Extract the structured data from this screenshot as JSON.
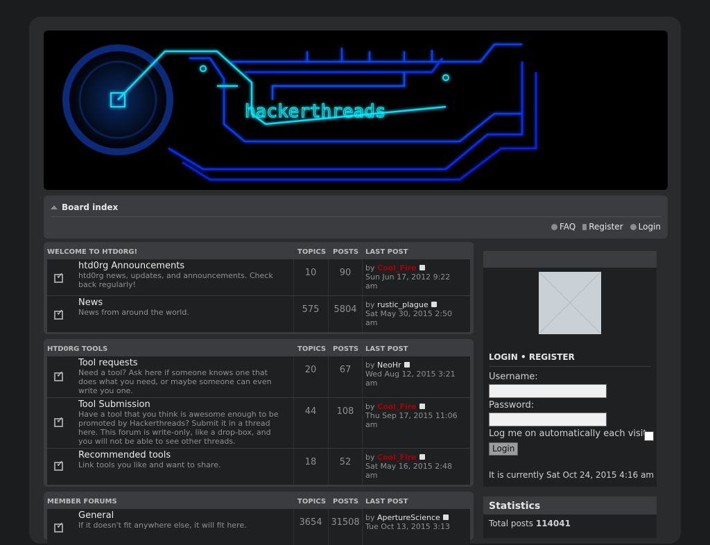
{
  "banner": {
    "title": "hackerthreads"
  },
  "nav": {
    "breadcrumb": "Board index",
    "faq": "FAQ",
    "register": "Register",
    "login": "Login"
  },
  "forums": {
    "col_topics": "TOPICS",
    "col_posts": "POSTS",
    "col_last": "LAST POST",
    "cat1": {
      "title": "WELCOME TO HTD0RG!",
      "rows": [
        {
          "name": "htd0rg Announcements",
          "desc": "htd0rg news, updates, and announcements. Check back regularly!",
          "topics": "10",
          "posts": "90",
          "by": "by",
          "user": "Cool_Fire",
          "date": "Sun Jun 17, 2012 9:22 am"
        },
        {
          "name": "News",
          "desc": "News from around the world.",
          "topics": "575",
          "posts": "5804",
          "by": "by",
          "user": "rustic_plague",
          "date": "Sat May 30, 2015 2:50 am"
        }
      ]
    },
    "cat2": {
      "title": "HTD0RG TOOLS",
      "rows": [
        {
          "name": "Tool requests",
          "desc": "Need a tool? Ask here if someone knows one that does what you need, or maybe someone can even write you one.",
          "topics": "20",
          "posts": "67",
          "by": "by",
          "user": "NeoHr",
          "date": "Wed Aug 12, 2015 3:21 am"
        },
        {
          "name": "Tool Submission",
          "desc": "Have a tool that you think is awesome enough to be promoted by Hackerthreads? Submit it in a thread here. This forum is write-only, like a drop-box, and you will not be able to see other threads.",
          "topics": "44",
          "posts": "108",
          "by": "by",
          "user": "Cool_Fire",
          "date": "Thu Sep 17, 2015 11:06 am"
        },
        {
          "name": "Recommended tools",
          "desc": "Link tools you like and want to share.",
          "topics": "18",
          "posts": "52",
          "by": "by",
          "user": "Cool_Fire",
          "date": "Sat May 16, 2015 2:48 am"
        }
      ]
    },
    "cat3": {
      "title": "MEMBER FORUMS",
      "rows": [
        {
          "name": "General",
          "desc": "If it doesn't fit anywhere else, it will fit here.",
          "topics": "3654",
          "posts": "31508",
          "by": "by",
          "user": "ApertureScience",
          "date": "Tue Oct 13, 2015 3:13"
        }
      ]
    }
  },
  "sidebar": {
    "login": "LOGIN",
    "bullet": "•",
    "register": "REGISTER",
    "username_label": "Username:",
    "password_label": "Password:",
    "remember_label": "Log me on automatically each visit",
    "login_button": "Login",
    "current_time": "It is currently Sat Oct 24, 2015 4:16 am"
  },
  "stats": {
    "title": "Statistics",
    "total_posts_label": "Total posts",
    "total_posts": "114041"
  }
}
